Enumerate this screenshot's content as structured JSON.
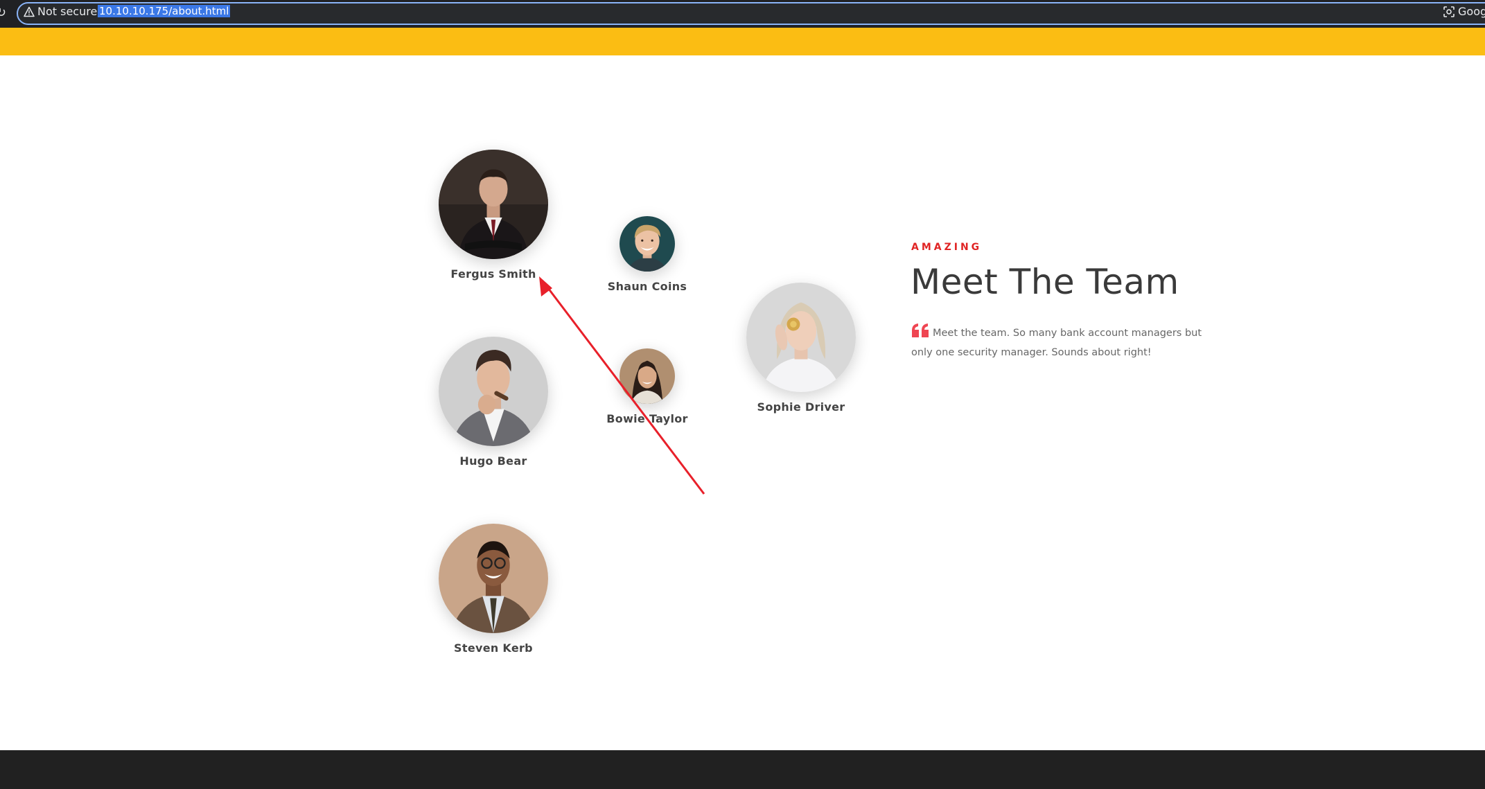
{
  "browser": {
    "security_label": "Not secure",
    "url": "10.10.10.175/about.html",
    "right_label": "Goog"
  },
  "team": {
    "members": [
      {
        "name": "Fergus Smith"
      },
      {
        "name": "Shaun Coins"
      },
      {
        "name": "Hugo Bear"
      },
      {
        "name": "Bowie Taylor"
      },
      {
        "name": "Sophie Driver"
      },
      {
        "name": "Steven Kerb"
      }
    ],
    "eyebrow": "AMAZING",
    "heading": "Meet The Team",
    "quote": "Meet the team. So many bank account managers but only one security manager. Sounds about right!"
  },
  "colors": {
    "accent_yellow": "#fbbd13",
    "accent_red": "#e02424",
    "footer": "#212121",
    "annotation_arrow": "#e8202a"
  }
}
